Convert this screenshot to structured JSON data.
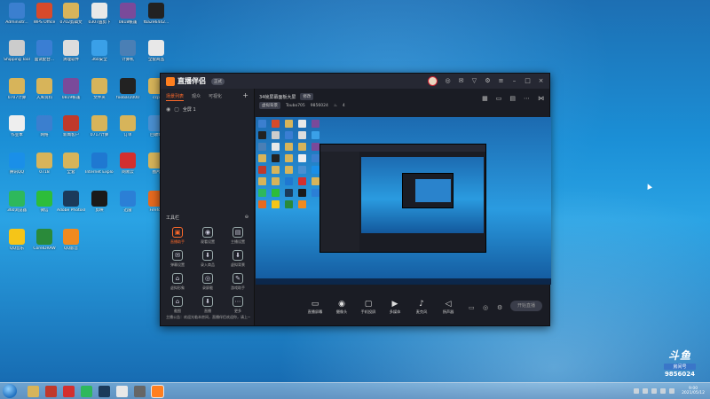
{
  "desktop_icons": [
    {
      "label": "Administr...",
      "color": "#3b7fcf"
    },
    {
      "label": "WPS Office",
      "color": "#d84a2b"
    },
    {
      "label": "0702剪辑文",
      "color": "#d7b45a"
    },
    {
      "label": "0307画剪下",
      "color": "#e8e8e8"
    },
    {
      "label": "0818帐篷",
      "color": "#7a4a9a"
    },
    {
      "label": "fba2e6442...",
      "color": "#222"
    },
    {
      "label": "Shipping Tool",
      "color": "#ccc"
    },
    {
      "label": "面试配合...",
      "color": "#3a7ed3"
    },
    {
      "label": "清理软件",
      "color": "#ddd"
    },
    {
      "label": "360安全",
      "color": "#3aa0e8"
    },
    {
      "label": "计算机",
      "color": "#4a7fb5"
    },
    {
      "label": "全套商品",
      "color": "#e8e8e8"
    },
    {
      "label": "0707计算",
      "color": "#d7b45a"
    },
    {
      "label": "入库资料",
      "color": "#d7b45a"
    },
    {
      "label": "0819帐篷",
      "color": "#7a4a9a"
    },
    {
      "label": "文件夹",
      "color": "#d7b45a"
    },
    {
      "label": "foobar2000",
      "color": "#222"
    },
    {
      "label": "ccp",
      "color": "#d7b45a"
    },
    {
      "label": "作业本",
      "color": "#eee"
    },
    {
      "label": "网络",
      "color": "#3b7fcf"
    },
    {
      "label": "新闻客户",
      "color": "#c0392b"
    },
    {
      "label": "0717计算",
      "color": "#d7b45a"
    },
    {
      "label": "订单",
      "color": "#d7b45a"
    },
    {
      "label": "回收站",
      "color": "#4a8fd0"
    },
    {
      "label": "腾讯QQ",
      "color": "#1a8fe8"
    },
    {
      "label": "0718",
      "color": "#d7b45a"
    },
    {
      "label": "全套",
      "color": "#d7b45a"
    },
    {
      "label": "Internet Explorer",
      "color": "#1f78d1"
    },
    {
      "label": "网易云",
      "color": "#d32f2f"
    },
    {
      "label": "图片",
      "color": "#d7b45a"
    },
    {
      "label": "360浏览器",
      "color": "#2eb85c"
    },
    {
      "label": "微信",
      "color": "#2dbd3a"
    },
    {
      "label": "Adobe Photoshop",
      "color": "#1b3a5a"
    },
    {
      "label": "剪映",
      "color": "#1a1a1a"
    },
    {
      "label": "迅雷",
      "color": "#2b7fd6"
    },
    {
      "label": "Firefox",
      "color": "#e66a1f"
    },
    {
      "label": "QQ音乐",
      "color": "#f5c518"
    },
    {
      "label": "CorelDRAW",
      "color": "#2a8a3a"
    },
    {
      "label": "QQ影音",
      "color": "#f08a1f"
    }
  ],
  "app": {
    "title": "直播伴侣",
    "version_badge": "正式",
    "tabs": [
      "场景列表",
      "观众",
      "可视化"
    ],
    "scene": "全屏 1",
    "room_name": "34帧屏幕面板大屏",
    "room_chip": "修改",
    "room_tag": "虚拟背景",
    "room_user": "Toubo705",
    "room_id": "9856024",
    "room_hot": "4",
    "tools_title": "工具栏",
    "tools": [
      {
        "label": "直播助手",
        "icon": "▣",
        "hot": true
      },
      {
        "label": "观看设置",
        "icon": "◉",
        "hot": false
      },
      {
        "label": "主播设置",
        "icon": "▤",
        "hot": false
      },
      {
        "label": "弹幕设置",
        "icon": "✉",
        "hot": false
      },
      {
        "label": "录入商品",
        "icon": "⬇",
        "hot": false
      },
      {
        "label": "虚拟背景",
        "icon": "⬇",
        "hot": false
      },
      {
        "label": "虚拟形象",
        "icon": "⌂",
        "hot": false
      },
      {
        "label": "录屏截",
        "icon": "◎",
        "hot": false
      },
      {
        "label": "游戏助手",
        "icon": "✎",
        "hot": false
      },
      {
        "label": "截图",
        "icon": "⌂",
        "hot": false
      },
      {
        "label": "直播",
        "icon": "⬇",
        "hot": false
      },
      {
        "label": "更多",
        "icon": "⋯",
        "hot": false
      }
    ],
    "log_text": "主播公告：欢迎光临本房间，直播伴侣欢迎你，请上一场直播",
    "controls": [
      {
        "label": "直播屏幕",
        "icon": "▭"
      },
      {
        "label": "摄像头",
        "icon": "◉"
      },
      {
        "label": "手机投屏",
        "icon": "▢"
      },
      {
        "label": "多媒体",
        "icon": "▶"
      },
      {
        "label": "麦克风",
        "icon": "♪"
      },
      {
        "label": "扬声器",
        "icon": "◁"
      }
    ],
    "go_live_label": "开始直播"
  },
  "douyu": {
    "logo": "斗鱼",
    "badge": "房间号",
    "room_number": "9856024"
  },
  "taskbar": {
    "time": "9:00",
    "date": "2021/05/12"
  }
}
